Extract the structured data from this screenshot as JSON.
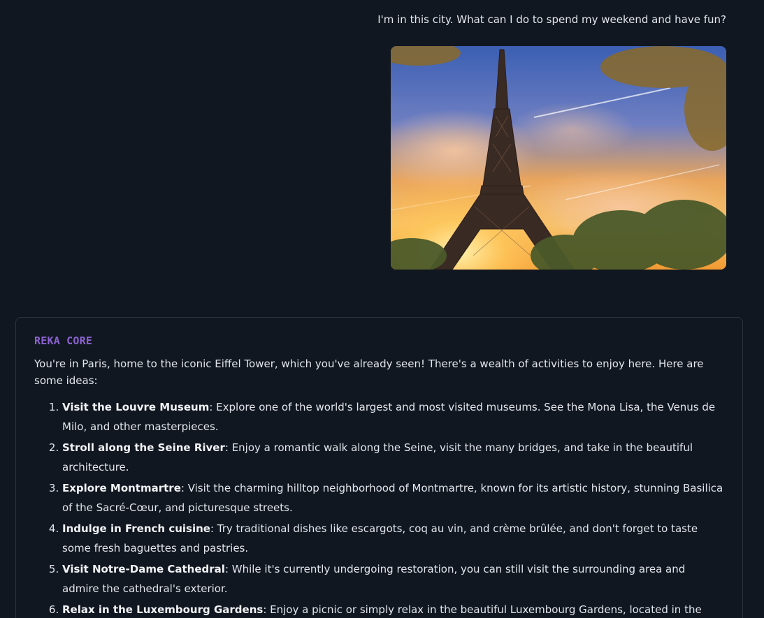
{
  "user": {
    "message": "I'm in this city. What can I do to spend my weekend and have fun?"
  },
  "assistant": {
    "model_name": "REKA CORE",
    "intro": "You're in Paris, home to the iconic Eiffel Tower, which you've already seen! There's a wealth of activities to enjoy here. Here are some ideas:",
    "ideas": [
      {
        "title": "Visit the Louvre Museum",
        "text": ": Explore one of the world's largest and most visited museums. See the Mona Lisa, the Venus de Milo, and other masterpieces."
      },
      {
        "title": "Stroll along the Seine River",
        "text": ": Enjoy a romantic walk along the Seine, visit the many bridges, and take in the beautiful architecture."
      },
      {
        "title": "Explore Montmartre",
        "text": ": Visit the charming hilltop neighborhood of Montmartre, known for its artistic history, stunning Basilica of the Sacré-Cœur, and picturesque streets."
      },
      {
        "title": "Indulge in French cuisine",
        "text": ": Try traditional dishes like escargots, coq au vin, and crème brûlée, and don't forget to taste some fresh baguettes and pastries."
      },
      {
        "title": "Visit Notre-Dame Cathedral",
        "text": ": While it's currently undergoing restoration, you can still visit the surrounding area and admire the cathedral's exterior."
      },
      {
        "title": "Relax in the Luxembourg Gardens",
        "text": ": Enjoy a picnic or simply relax in the beautiful Luxembourg Gardens, located in the heart of Paris."
      }
    ]
  },
  "colors": {
    "background": "#111720",
    "accent": "#8b62d2",
    "card_border": "#2c333e"
  }
}
